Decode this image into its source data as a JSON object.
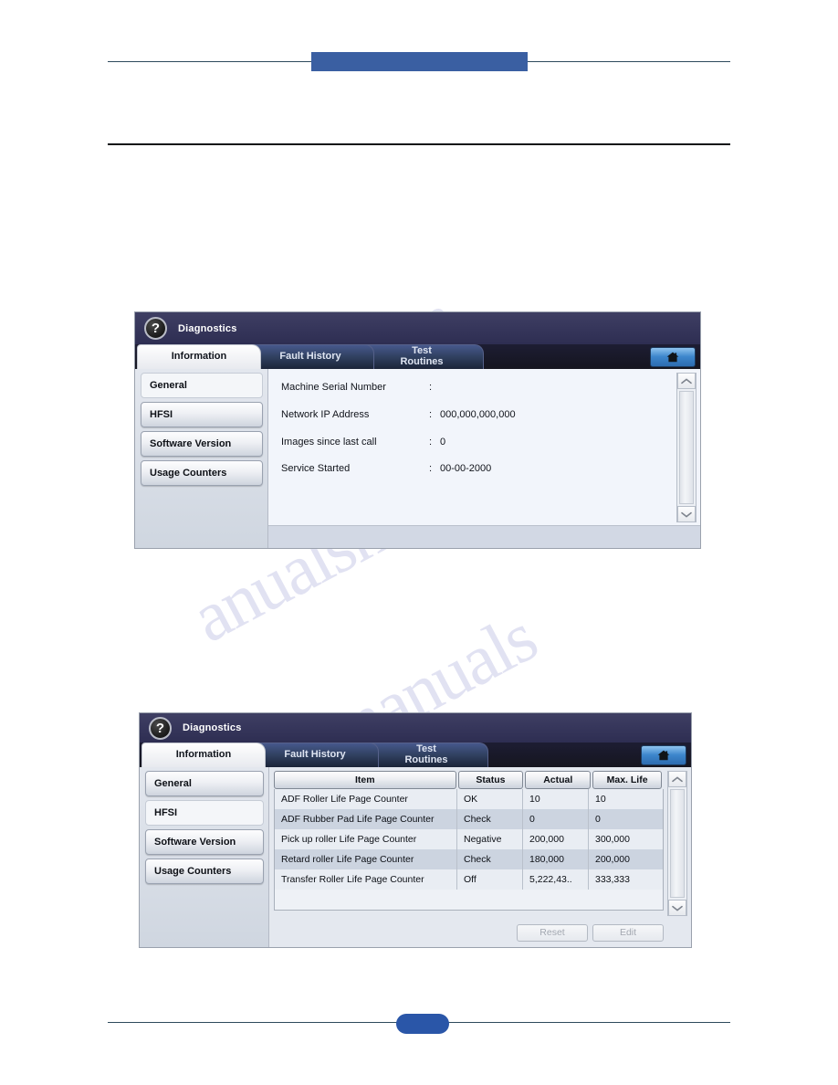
{
  "page": {
    "header_block_color": "#3a5fa2",
    "footer_pill_color": "#2a56a8",
    "watermark_line1": "hive.com",
    "watermark_line2": "anualshive",
    "watermark_line3": "manuals"
  },
  "panel_one": {
    "title": "Diagnostics",
    "help_icon_glyph": "?",
    "tabs": [
      {
        "label": "Information",
        "active": true
      },
      {
        "label": "Fault History",
        "active": false
      },
      {
        "label": "Test\nRoutines",
        "active": false
      }
    ],
    "home_button_label": "home-button",
    "sidebar": [
      {
        "label": "General",
        "selected": true
      },
      {
        "label": "HFSI",
        "selected": false
      },
      {
        "label": "Software Version",
        "selected": false
      },
      {
        "label": "Usage Counters",
        "selected": false
      }
    ],
    "info_rows": [
      {
        "label": "Machine Serial Number",
        "colon": ":",
        "value": ""
      },
      {
        "label": "Network IP Address",
        "colon": ":",
        "value": "000,000,000,000"
      },
      {
        "label": "Images since last call",
        "colon": ":",
        "value": "0"
      },
      {
        "label": "Service Started",
        "colon": ":",
        "value": "00-00-2000"
      }
    ],
    "scroll_up_icon": "chevron-up-icon",
    "scroll_down_icon": "chevron-down-icon"
  },
  "panel_two": {
    "title": "Diagnostics",
    "help_icon_glyph": "?",
    "tabs": [
      {
        "label": "Information",
        "active": true
      },
      {
        "label": "Fault History",
        "active": false
      },
      {
        "label": "Test\nRoutines",
        "active": false
      }
    ],
    "sidebar": [
      {
        "label": "General",
        "selected": false
      },
      {
        "label": "HFSI",
        "selected": true
      },
      {
        "label": "Software Version",
        "selected": false
      },
      {
        "label": "Usage Counters",
        "selected": false
      }
    ],
    "table": {
      "columns": [
        "Item",
        "Status",
        "Actual",
        "Max. Life"
      ],
      "rows": [
        [
          "ADF Roller Life Page Counter",
          "OK",
          "10",
          "10"
        ],
        [
          "ADF Rubber Pad Life Page Counter",
          "Check",
          "0",
          "0"
        ],
        [
          "Pick up roller Life Page Counter",
          "Negative",
          "200,000",
          "300,000"
        ],
        [
          "Retard roller Life Page Counter",
          "Check",
          "180,000",
          "200,000"
        ],
        [
          "Transfer Roller Life Page Counter",
          "Off",
          "5,222,43..",
          "333,333"
        ]
      ]
    },
    "buttons": {
      "reset": "Reset",
      "edit": "Edit"
    }
  }
}
